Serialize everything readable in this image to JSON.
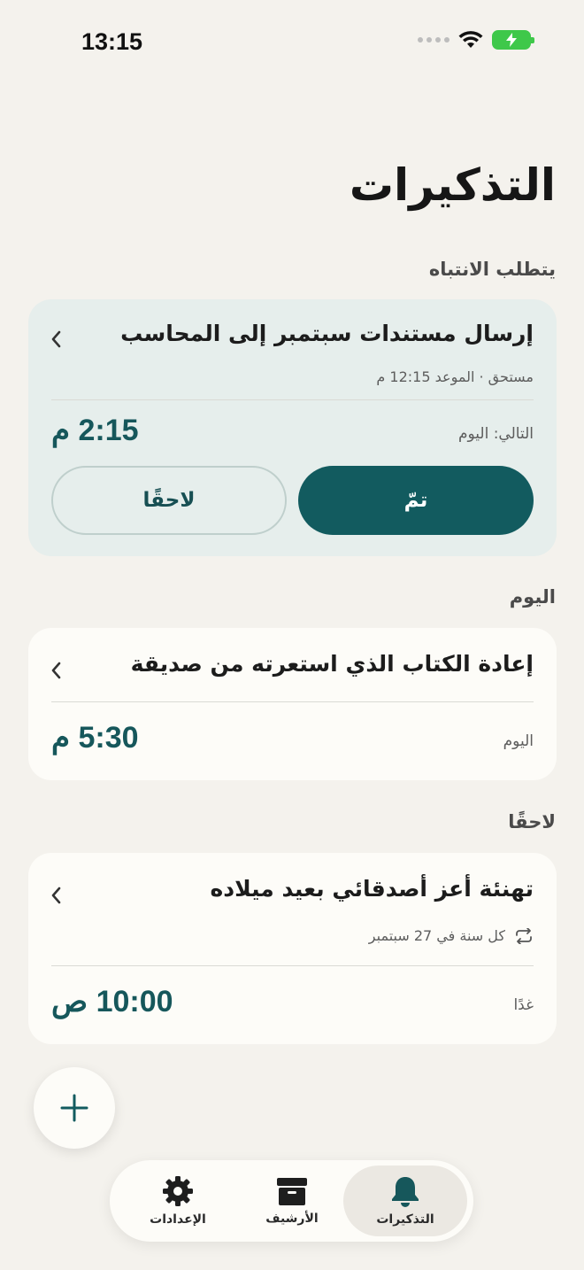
{
  "status_bar": {
    "time": "13:15"
  },
  "page_title": "التذكيرات",
  "sections": {
    "attention": "يتطلب الانتباه",
    "today": "اليوم",
    "later": "لاحقًا"
  },
  "attention_card": {
    "title": "إرسال مستندات سبتمبر إلى المحاسب",
    "subtitle": "مستحق · الموعد 12:15 م",
    "next_label": "التالي: اليوم",
    "time": "2:15 م",
    "done_label": "تمّ",
    "later_label": "لاحقًا"
  },
  "today_card": {
    "title": "إعادة الكتاب الذي استعرته من صديقة",
    "day_label": "اليوم",
    "time": "5:30 م"
  },
  "later_card": {
    "title": "تهنئة أعز أصدقائي بعيد ميلاده",
    "repeat_text": "كل سنة في 27 سبتمبر",
    "day_label": "غدًا",
    "time": "10:00 ص"
  },
  "tabbar": {
    "reminders_label": "التذكيرات",
    "archive_label": "الأرشيف",
    "settings_label": "الإعدادات"
  },
  "colors": {
    "accent": "#125b5f",
    "background": "#f4f2ed",
    "card": "#fdfcf8",
    "attention_card": "#e6eeec",
    "time_text": "#16575b"
  }
}
